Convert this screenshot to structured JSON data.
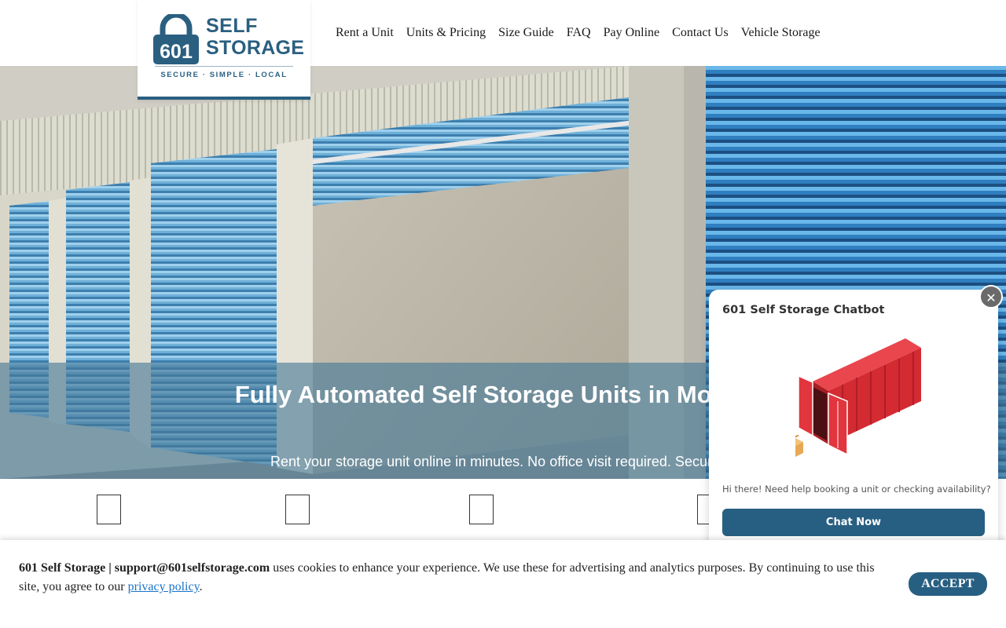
{
  "logo": {
    "number": "601",
    "line1": "SELF",
    "line2": "STORAGE",
    "tagline": "SECURE · SIMPLE · LOCAL"
  },
  "nav": {
    "items": [
      {
        "label": "Rent a Unit"
      },
      {
        "label": "Units & Pricing"
      },
      {
        "label": "Size Guide"
      },
      {
        "label": "FAQ"
      },
      {
        "label": "Pay Online"
      },
      {
        "label": "Contact Us"
      },
      {
        "label": "Vehicle Storage"
      }
    ]
  },
  "hero": {
    "title": "Fully Automated Self Storage Units in Mocksville NC",
    "subtitle": "Rent your storage unit online in minutes. No office visit required. Secure"
  },
  "chatbot": {
    "title": "601 Self Storage Chatbot",
    "message": "Hi there! Need help booking a unit or checking availability?",
    "button_label": "Chat Now",
    "close_glyph": "✕"
  },
  "cookie": {
    "company": "601 Self Storage | support@601selfstorage.com",
    "text": " uses cookies to enhance your experience. We use these for advertising and analytics purposes. By continuing to use this site, you agree to our ",
    "link_label": "privacy policy",
    "end": ".",
    "accept_label": "ACCEPT"
  },
  "colors": {
    "brand_blue": "#2a5f80",
    "button_blue": "#275f82",
    "shutter_blue": "#3f8fc4",
    "container_red": "#d42a32"
  }
}
